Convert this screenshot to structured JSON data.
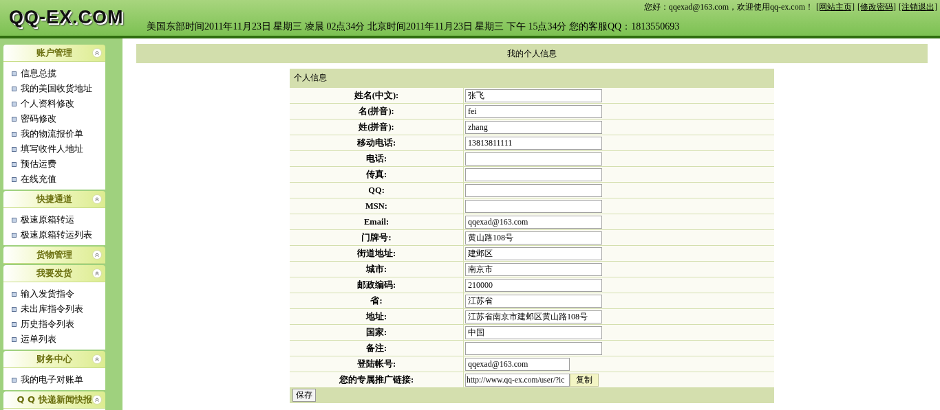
{
  "header": {
    "logo": "QQ-EX.COM",
    "greeting": "您好：qqexad@163.com，欢迎使用qq-ex.com！",
    "links": [
      "[网站主页]",
      "[修改密码]",
      "[注销退出]"
    ],
    "time": "美国东部时间2011年11月23日 星期三 凌晨 02点34分 北京时间2011年11月23日 星期三 下午 15点34分 您的客服QQ：1813550693"
  },
  "sidebar": [
    {
      "title": "账户管理",
      "items": [
        "信息总揽",
        "我的美国收货地址",
        "个人资料修改",
        "密码修改",
        "我的物流报价单",
        "填写收件人地址",
        "预估运费",
        "在线充值"
      ]
    },
    {
      "title": "快捷通道",
      "items": [
        "极速原箱转运",
        "极速原箱转运列表"
      ]
    },
    {
      "title": "货物管理"
    },
    {
      "title": "我要发货",
      "items": [
        "输入发货指令",
        "未出库指令列表",
        "历史指令列表",
        "运单列表"
      ]
    },
    {
      "title": "财务中心",
      "items": [
        "我的电子对账单"
      ]
    },
    {
      "title": "Q Q 快递新闻快报"
    }
  ],
  "page_title": "我的个人信息",
  "form": {
    "title": "个人信息",
    "rows": [
      {
        "label": "姓名(中文):",
        "value": "张飞",
        "kind": "text"
      },
      {
        "label": "名(拼音):",
        "value": "fei",
        "kind": "text"
      },
      {
        "label": "姓(拼音):",
        "value": "zhang",
        "kind": "text"
      },
      {
        "label": "移动电话:",
        "value": "13813811111",
        "kind": "text"
      },
      {
        "label": "电话:",
        "value": "",
        "kind": "text"
      },
      {
        "label": "传真:",
        "value": "",
        "kind": "text"
      },
      {
        "label": "QQ:",
        "value": "",
        "kind": "text"
      },
      {
        "label": "MSN:",
        "value": "",
        "kind": "text"
      },
      {
        "label": "Email:",
        "value": "qqexad@163.com",
        "kind": "text"
      },
      {
        "label": "门牌号:",
        "value": "黄山路108号",
        "kind": "text"
      },
      {
        "label": "街道地址:",
        "value": "建邺区",
        "kind": "text"
      },
      {
        "label": "城市:",
        "value": "南京市",
        "kind": "text"
      },
      {
        "label": "邮政编码:",
        "value": "210000",
        "kind": "text"
      },
      {
        "label": "省:",
        "value": "江苏省",
        "kind": "text"
      },
      {
        "label": "地址:",
        "value": "江苏省南京市建邺区黄山路108号",
        "kind": "text"
      },
      {
        "label": "国家:",
        "value": "中国",
        "kind": "text"
      },
      {
        "label": "备注:",
        "value": "",
        "kind": "text"
      },
      {
        "label": "登陆帐号:",
        "value": "qqexad@163.com",
        "kind": "short"
      },
      {
        "label": "您的专属推广链接:",
        "value": "http://www.qq-ex.com/user/?ic",
        "kind": "link",
        "button": "复制"
      }
    ],
    "save": "保存"
  }
}
